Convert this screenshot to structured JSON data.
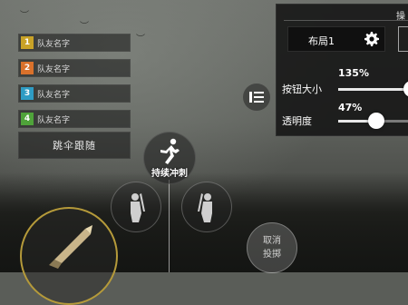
{
  "team": {
    "members": [
      {
        "number": "1",
        "name": "队友名字",
        "color": "#c9a227"
      },
      {
        "number": "2",
        "name": "队友名字",
        "color": "#d9712b"
      },
      {
        "number": "3",
        "name": "队友名字",
        "color": "#2e9cc4"
      },
      {
        "number": "4",
        "name": "队友名字",
        "color": "#4fa33a"
      }
    ],
    "follow_label": "跳伞跟随"
  },
  "controls": {
    "sprint_label": "持续冲刺",
    "cancel_throw_line1": "取消",
    "cancel_throw_line2": "投掷"
  },
  "settings_panel": {
    "title": "操",
    "layout_name": "布局1",
    "button_size_label": "按钮大小",
    "button_size_value": "135%",
    "button_size_fraction": 0.9,
    "opacity_label": "透明度",
    "opacity_value": "47%",
    "opacity_fraction": 0.47
  },
  "icons": {
    "sprint": "running-person-icon",
    "lean_left": "lean-left-icon",
    "lean_right": "lean-right-icon",
    "weapon": "bullet-icon",
    "settings": "gear-icon",
    "side": "list-toggle-icon"
  },
  "colors": {
    "weapon_ring": "#b59a3a",
    "panel_bg": "#141414"
  }
}
